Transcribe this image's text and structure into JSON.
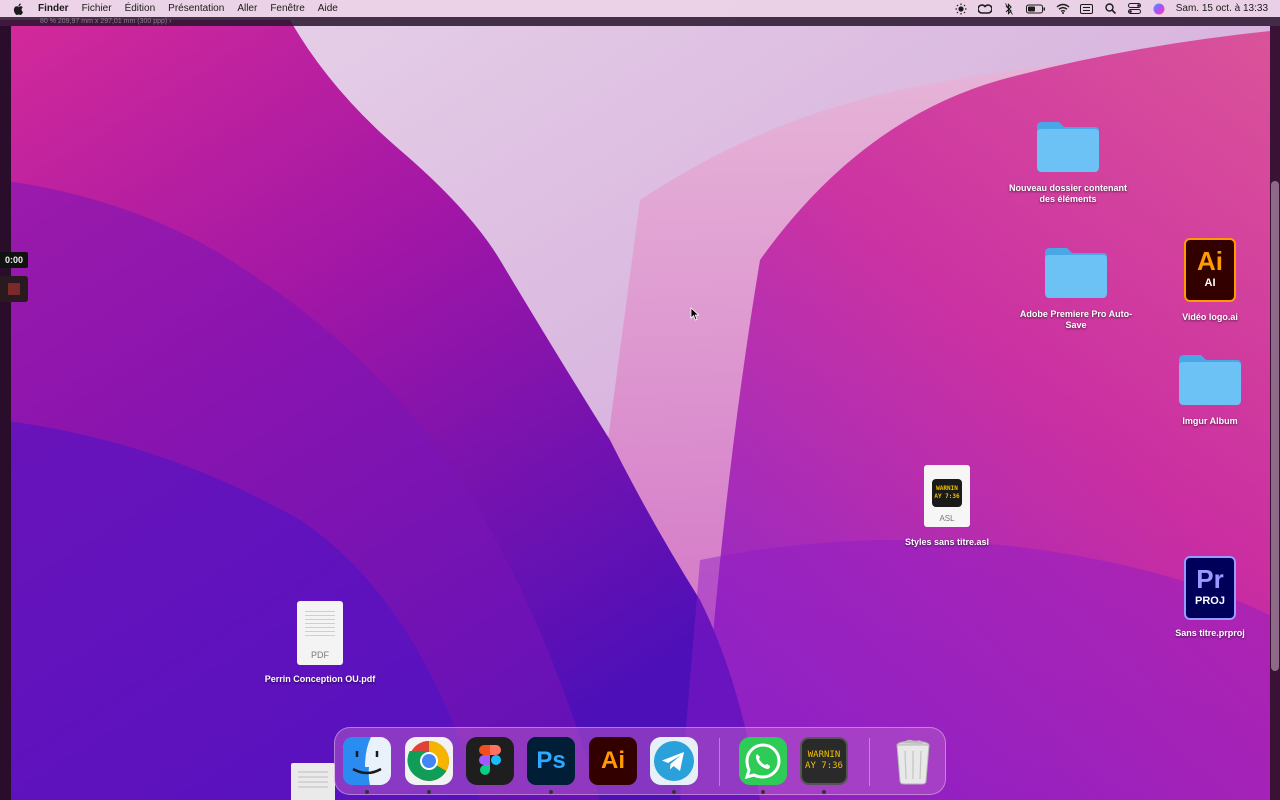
{
  "menubar": {
    "app_name": "Finder",
    "items": [
      "Fichier",
      "Édition",
      "Présentation",
      "Aller",
      "Fenêtre",
      "Aide"
    ],
    "clock": "Sam. 15 oct. à  13:33",
    "status_icons": [
      "brightness-icon",
      "creative-cloud-icon",
      "bluetooth-icon",
      "battery-icon",
      "wifi-icon",
      "keyboard-input-icon",
      "search-icon",
      "control-center-icon",
      "siri-icon"
    ]
  },
  "ghostbar": {
    "text": "80 %      209,97 mm x 297,01 mm (300 ppp)  ›"
  },
  "recorder": {
    "time": "0:00"
  },
  "desktop": {
    "folder_new": "Nouveau dossier contenant des éléments",
    "folder_premiere": "Adobe Premiere Pro Auto-Save",
    "file_ai": "Vidéo logo.ai",
    "file_ai_badge": "Ai",
    "file_ai_sub": "AI",
    "folder_imgur": "Imgur Album",
    "file_asl": "Styles sans titre.asl",
    "file_asl_ext": "ASL",
    "file_asl_screen_line1": "WARNIN",
    "file_asl_screen_line2": "AY 7:36",
    "file_prproj": "Sans titre.prproj",
    "file_prproj_badge": "Pr",
    "file_prproj_sub": "PROJ",
    "file_pdf": "Perrin Conception OU.pdf",
    "file_pdf_ext": "PDF"
  },
  "dock": {
    "apps": [
      "Finder",
      "Google Chrome",
      "Figma",
      "Photoshop",
      "Illustrator",
      "Telegram",
      "WhatsApp",
      "Console",
      "Corbeille"
    ],
    "ps_label": "Ps",
    "ai_label": "Ai",
    "console_line1": "WARNIN",
    "console_line2": "AY 7:36"
  },
  "colors": {
    "folder": "#5fb8f0",
    "ai_bg": "#330000",
    "ai_accent": "#ff9a00",
    "pr_bg": "#00005b",
    "pr_accent": "#9999ff",
    "ps_bg": "#001e36",
    "ps_accent": "#31a8ff"
  }
}
